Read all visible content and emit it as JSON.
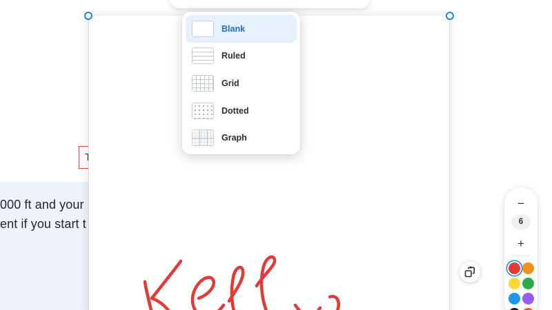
{
  "background": {
    "textbox_text": "T",
    "panel_lines": [
      "000 ft and your",
      "ent if you start t"
    ]
  },
  "top_toolbar": {
    "icons": [
      "anchor-icon",
      "minus-icon",
      "link-icon",
      "minus-icon"
    ]
  },
  "template_menu": {
    "selected": "Blank",
    "items": [
      {
        "label": "Blank",
        "thumb": "blank"
      },
      {
        "label": "Ruled",
        "thumb": "ruled"
      },
      {
        "label": "Grid",
        "thumb": "grid"
      },
      {
        "label": "Dotted",
        "thumb": "dotted"
      },
      {
        "label": "Graph",
        "thumb": "graph"
      }
    ]
  },
  "pen_panel": {
    "minus_label": "−",
    "size_value": "6",
    "plus_label": "+",
    "selected_color": "#e53935",
    "colors": [
      "#e53935",
      "#f39019",
      "#fdd835",
      "#2eaa4a",
      "#1e96f0",
      "#9a5cf0",
      "#222222",
      "#ef5a2a"
    ]
  },
  "ink_color": "#e53935"
}
